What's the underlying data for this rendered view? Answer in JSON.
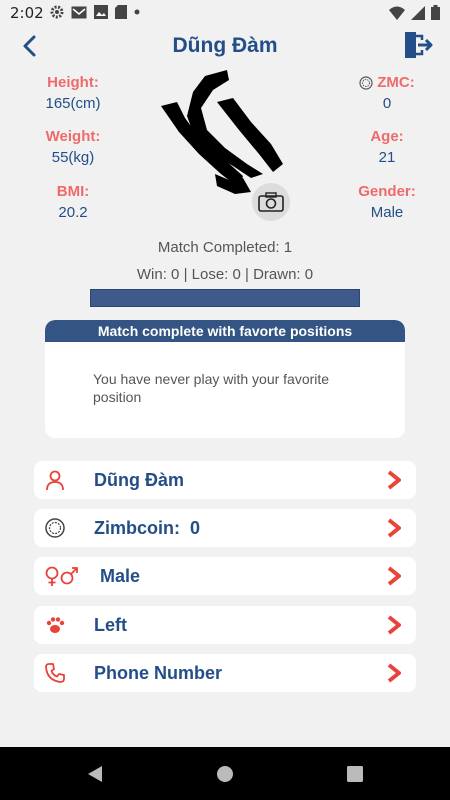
{
  "status_bar": {
    "time": "2:02"
  },
  "header": {
    "title": "Dũng Đàm"
  },
  "stats": {
    "height": {
      "label": "Height:",
      "value": "165(cm)"
    },
    "weight": {
      "label": "Weight:",
      "value": "55(kg)"
    },
    "bmi": {
      "label": "BMI:",
      "value": "20.2"
    },
    "zmc": {
      "label": "ZMC:",
      "value": "0"
    },
    "age": {
      "label": "Age:",
      "value": "21"
    },
    "gender": {
      "label": "Gender:",
      "value": "Male"
    }
  },
  "summary": {
    "completed": "Match Completed: 1",
    "record": "Win: 0 | Lose: 0 | Drawn: 0"
  },
  "favorite": {
    "header": "Match complete with favorte positions",
    "message": "You have never play with your favorite position"
  },
  "menu": [
    {
      "label": "Dũng Đàm",
      "icon": "person-icon"
    },
    {
      "label": "Zimbcoin:  0",
      "icon": "coin-icon"
    },
    {
      "label": "Male",
      "icon": "gender-icon"
    },
    {
      "label": "Left",
      "icon": "paw-icon"
    },
    {
      "label": "Phone Number",
      "icon": "phone-icon"
    }
  ],
  "colors": {
    "accent": "#234e87",
    "label_red": "#ef6b6b",
    "arrow_red": "#e8433a",
    "bar_blue": "#3d5a8a"
  }
}
